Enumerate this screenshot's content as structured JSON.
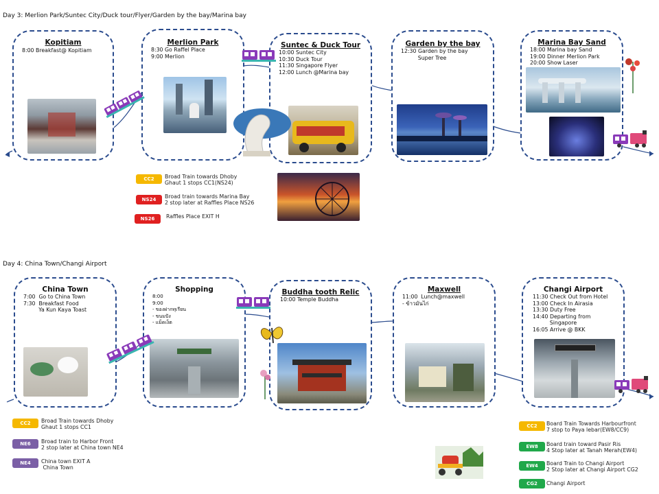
{
  "day3": {
    "title": "Day  3: Merlion Park/Suntec City/Duck tour/Flyer/Garden by the bay/Marina bay",
    "stops": [
      {
        "title": "Kopitiam",
        "lines": "8:00 Breakfast@ Kopitiam"
      },
      {
        "title": "Merlion Park",
        "lines": "8:30 Go Raffel Place\n9:00 Merlion"
      },
      {
        "title": "Suntec & Duck Tour",
        "lines": "10:00 Suntec City\n10:30 Duck Tour\n11:30 Singapore Flyer\n12:00 Lunch @Marina bay"
      },
      {
        "title": "Garden by the bay",
        "lines": "12:30 Garden by the bay\n          Super Tree"
      },
      {
        "title": "Marina Bay Sand",
        "lines": "18:00 Marina bay Sand\n19:00 Dinner Merlion Park\n20:00 Show Laser"
      }
    ],
    "transit": [
      {
        "code": "CC2",
        "color": "#f5b800",
        "text": "Broad Train towards Dhoby\nGhaut 1 stops CC1(NS24)"
      },
      {
        "code": "NS24",
        "color": "#e02020",
        "text": "Broad train towards Marina Bay\n2 stop later at Raffles Place NS26"
      },
      {
        "code": "NS26",
        "color": "#e02020",
        "text": "Raffles Place EXIT H"
      }
    ]
  },
  "day4": {
    "title": "Day 4: China Town/Changi Airport",
    "stops": [
      {
        "title": "China Town",
        "lines": "7:00  Go to China Town\n7:30  Breakfast Food\n         Ya Kun Kaya Toast"
      },
      {
        "title": "Shopping",
        "lines": "8:00\n9:00\n- ของฝากทุเรียน\n- ขนมปัง\n- แม็ดเง็ต"
      },
      {
        "title": "Buddha tooth Relic",
        "lines": "10:00 Temple Buddha"
      },
      {
        "title": "Maxwell",
        "lines": "11:00  Lunch@maxwell\n- ข้าวมันไก่"
      },
      {
        "title": "Changi Airport",
        "lines": "11:30 Check Out from Hotel\n13:00 Check In Airasia\n13:30 Duty Free\n14:40 Departing from\n          Singapore\n16:05 Arrive @ BKK"
      }
    ],
    "transit_left": [
      {
        "code": "CC2",
        "color": "#f5b800",
        "text": "Broad Train towards Dhoby\nGhaut 1 stops CC1"
      },
      {
        "code": "NE6",
        "color": "#7b5fa6",
        "text": "Broad train to Harbor Front\n2 stop later at China town NE4"
      },
      {
        "code": "NE4",
        "color": "#7b5fa6",
        "text": "China town EXIT A\n China Town"
      }
    ],
    "transit_right": [
      {
        "code": "CC2",
        "color": "#f5b800",
        "text": "Board Train Towards Harbourfront\n7 stop to Paya lebar(EW8/CC9)"
      },
      {
        "code": "EW8",
        "color": "#20a84a",
        "text": "Board train toward Pasir Ris\n4 Stop later at Tanah Merah(EW4)"
      },
      {
        "code": "EW4",
        "color": "#20a84a",
        "text": "Board Train to Changi Airport\n2 Stop later at Changi Airport CG2"
      },
      {
        "code": "CG2",
        "color": "#20a84a",
        "text": "Changi Airport"
      }
    ]
  },
  "icons": [
    "train-icon",
    "merlion-icon",
    "butterfly-icon",
    "flower-icon",
    "scooter-icon",
    "ferris-wheel-icon"
  ]
}
